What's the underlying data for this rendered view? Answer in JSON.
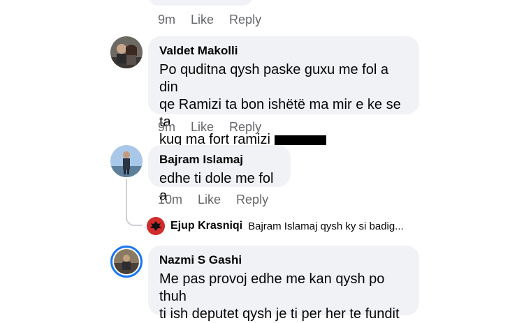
{
  "comments": [
    {
      "time": "9m",
      "like": "Like",
      "reply": "Reply"
    },
    {
      "author": "Valdet Makolli",
      "lines": [
        "Po quditna qysh paske guxu me fol a din",
        "qe Ramizi ta bon ishëtë ma mir e ke se ta",
        "kuq ma fort ramizi"
      ],
      "time": "9m",
      "like": "Like",
      "reply": "Reply"
    },
    {
      "author": "Bajram Islamaj",
      "lines": [
        "edhe ti dole me fol a"
      ],
      "time": "10m",
      "like": "Like",
      "reply": "Reply"
    },
    {
      "author": "Nazmi S Gashi",
      "lines": [
        "Me pas provoj edhe me kan qysh po thuh",
        "ti ish deputet qysh je ti per her te fundit"
      ]
    }
  ],
  "reply_preview": {
    "author": "Ejup Krasniqi",
    "text": "Bajram Islamaj qysh ky si badig..."
  },
  "colors": {
    "bubble": "#f0f2f5",
    "meta": "#65676b",
    "avatar_ring": "#1877f2"
  }
}
